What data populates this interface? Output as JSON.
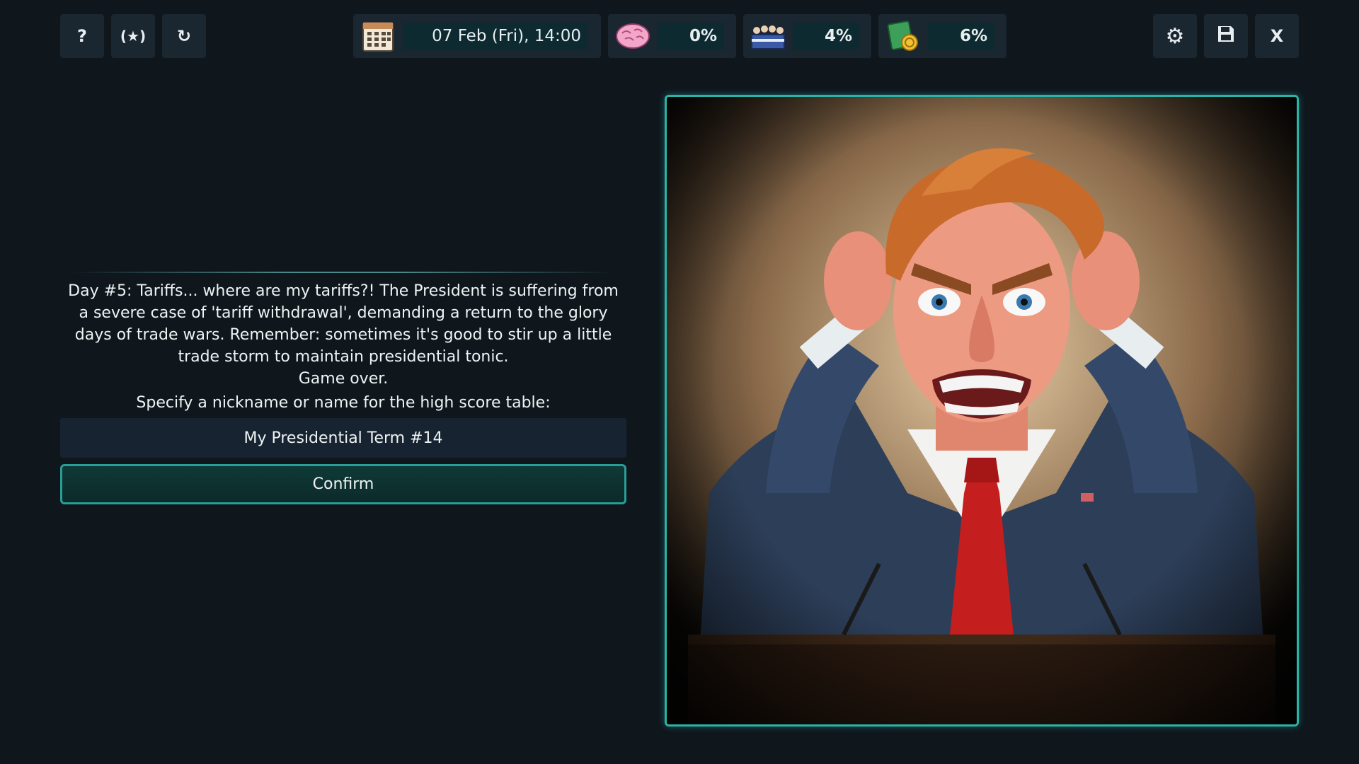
{
  "toolbar_left": {
    "help_label": "?",
    "achievements_label": "(★)",
    "restart_label": "↻"
  },
  "stats": {
    "date": "07 Feb (Fri), 14:00",
    "mind": "0%",
    "approval": "4%",
    "economy": "6%"
  },
  "toolbar_right": {
    "settings_label": "⚙",
    "save_label": "💾",
    "close_label": "X"
  },
  "story": {
    "text": "Day #5: Tariffs... where are my tariffs?! The President is suffering from a severe case of 'tariff withdrawal', demanding a return to the glory days of trade wars. Remember: sometimes it's good to stir up a little trade storm to maintain presidential tonic.",
    "game_over": "Game over.",
    "prompt": "Specify a nickname or name for the high score table:"
  },
  "name_input": {
    "value": "My Presidential Term #14"
  },
  "confirm_label": "Confirm",
  "colors": {
    "background": "#0f161c",
    "panel": "#1a2630",
    "accent": "#2bb3a8",
    "tie": "#c41e1e"
  }
}
